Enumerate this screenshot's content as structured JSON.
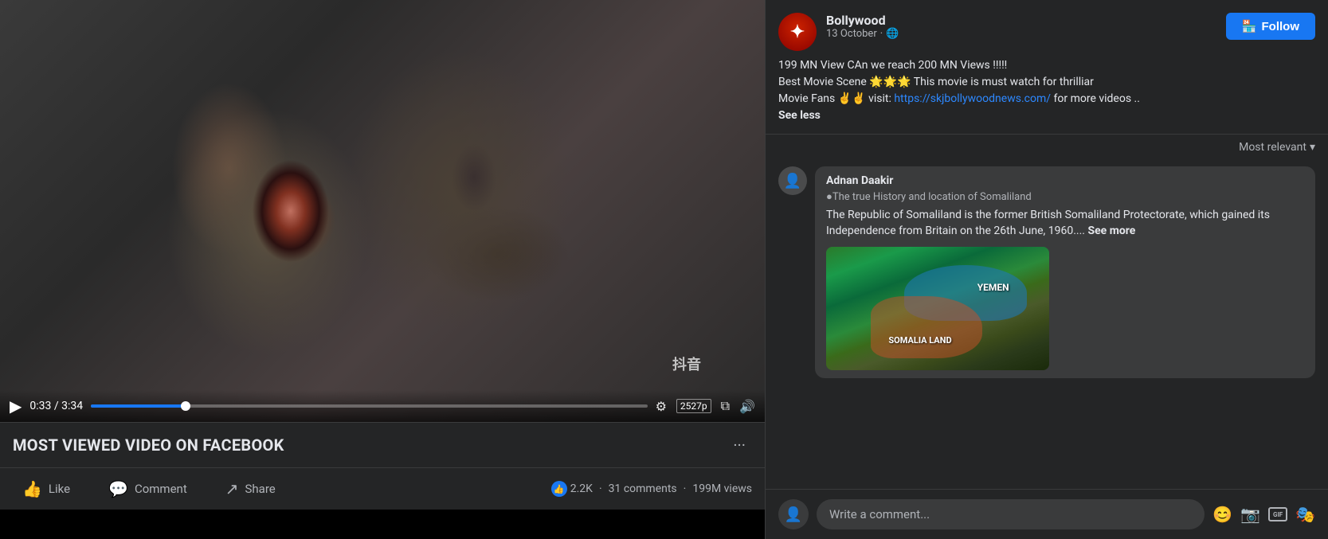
{
  "video": {
    "current_time": "0:33",
    "total_time": "3:34",
    "progress_percent": 17,
    "quality": "2527p",
    "tiktok_watermark": "抖音"
  },
  "post": {
    "title": "MOST VIEWED VIDEO ON FACEBOOK",
    "page_name": "Bollywood",
    "post_date": "13 October",
    "visibility": "🌐",
    "caption_line1": "199 MN View CAn we reach 200 MN Views !!!!!",
    "caption_line2": "Best Movie Scene 🌟🌟🌟 This movie is must watch for thrilliar",
    "caption_line3": "Movie Fans ✌✌ visit:",
    "caption_link": "https://skjbollywoodnews.com/",
    "caption_line4": "for more videos ..",
    "see_less": "See less",
    "follow_label": "Follow",
    "stats_likes": "2.2K",
    "stats_comments": "31 comments",
    "stats_views": "199M views",
    "more_options": "···"
  },
  "actions": {
    "like_label": "Like",
    "comment_label": "Comment",
    "share_label": "Share"
  },
  "comments": {
    "sort_label": "Most relevant",
    "items": [
      {
        "author": "Adnan Daakir",
        "subtitle": "●The true History and location of Somaliland",
        "text": "The Republic of Somaliland is the former British Somaliland Protectorate, which gained its Independence from Britain on the 26th June, 1960....",
        "see_more": "See more",
        "has_map": true,
        "map_label_1": "YEMEN",
        "map_label_2": "SOMALIA LAND"
      }
    ]
  },
  "comment_input": {
    "placeholder": "Write a comment..."
  },
  "icons": {
    "play": "▶",
    "settings": "⚙",
    "fullscreen": "⛶",
    "volume": "🔊",
    "pip": "⧉",
    "like_thumb": "👍",
    "comment_bubble": "💬",
    "share_arrow": "↗",
    "follow_icon": "🏪",
    "globe": "🌐",
    "chevron_down": "▾",
    "emoji": "😊",
    "camera": "📷",
    "gif": "GIF",
    "sticker": "🎭"
  }
}
